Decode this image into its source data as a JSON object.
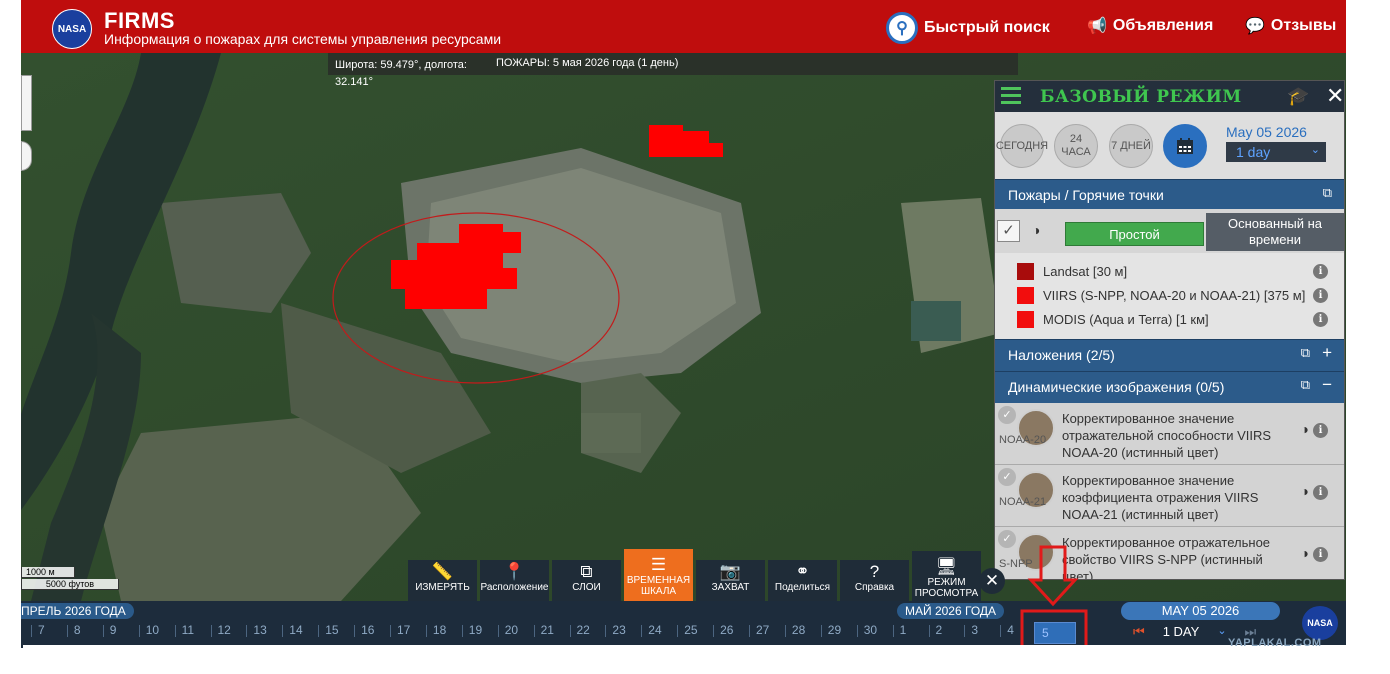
{
  "header": {
    "logo_text": "NASA",
    "title": "FIRMS",
    "subtitle": "Информация о пожарах для системы управления ресурсами",
    "quick_search": "Быстрый поиск",
    "announcements": "Объявления",
    "feedback": "Отзывы",
    "colors": {
      "bar": "#bf0d0d",
      "search_ring": "#2a6fbf"
    }
  },
  "map": {
    "coords": "Широта: 59.479°, долгота: 32.141°",
    "fires_date": "ПОЖАРЫ: 5 мая 2026 года (1 день)",
    "scale_metric": "1000 м",
    "scale_imperial": "5000 футов",
    "fire_color": "#ff0000"
  },
  "panel": {
    "mode_title": "БАЗОВЫЙ РЕЖИМ",
    "quick_dates": [
      {
        "label": "СЕГОДНЯ"
      },
      {
        "label": "24 ЧАСА"
      },
      {
        "label": "7 ДНЕЙ"
      }
    ],
    "calendar_icon": "calendar-icon",
    "selected_date": "May 05 2026",
    "selected_range": "1 day",
    "sections": {
      "fires": "Пожары / Горячие точки",
      "overlays": "Наложения (2/5)",
      "dynamic": "Динамические изображения (0/5)"
    },
    "fire_modes": {
      "simple": "Простой",
      "time_based": "Основанный на времени"
    },
    "fire_layers": [
      {
        "label": "Landsat [30 м]",
        "color": "#a80c0c"
      },
      {
        "label": "VIIRS (S-NPP, NOAA-20 и NOAA-21) [375 м]",
        "color": "#f20d0d"
      },
      {
        "label": "MODIS (Aqua и Terra) [1 км]",
        "color": "#f20d0d"
      }
    ],
    "dynamic_layers": [
      {
        "satellite": "NOAA-20",
        "label": "Корректированное значение отражательной способности VIIRS NOAA-20 (истинный цвет)"
      },
      {
        "satellite": "NOAA-21",
        "label": "Корректированное значение коэффициента отражения VIIRS NOAA-21 (истинный цвет)"
      },
      {
        "satellite": "S-NPP",
        "label": "Корректированное отражательное свойство VIIRS S-NPP (истинный цвет)"
      }
    ]
  },
  "toolbar": [
    {
      "label": "ИЗМЕРЯТЬ",
      "icon": "ruler-icon"
    },
    {
      "label": "Расположение",
      "icon": "location-pin-icon"
    },
    {
      "label": "СЛОИ",
      "icon": "layers-icon"
    },
    {
      "label": "ВРЕМЕННАЯ ШКАЛА",
      "icon": "sliders-icon",
      "active": true,
      "color": "#ee6e1e"
    },
    {
      "label": "ЗАХВАТ",
      "icon": "camera-icon"
    },
    {
      "label": "Поделиться",
      "icon": "share-icon"
    },
    {
      "label": "Справка",
      "icon": "help-icon"
    },
    {
      "label": "РЕЖИМ ПРОСМОТРА",
      "icon": "monitor-icon"
    }
  ],
  "timeline": {
    "month_left": "ПРЕЛЬ 2026 ГОДА",
    "month_right": "МАЙ 2026 ГОДА",
    "days": [
      "7",
      "8",
      "9",
      "10",
      "11",
      "12",
      "13",
      "14",
      "15",
      "16",
      "17",
      "18",
      "19",
      "20",
      "21",
      "22",
      "23",
      "24",
      "25",
      "26",
      "27",
      "28",
      "29",
      "30",
      "1",
      "2",
      "3",
      "4"
    ],
    "selected_day": "5",
    "current_date": "MAY 05 2026",
    "range": "1 DAY"
  },
  "watermark": "YAPLAKAL.COM"
}
